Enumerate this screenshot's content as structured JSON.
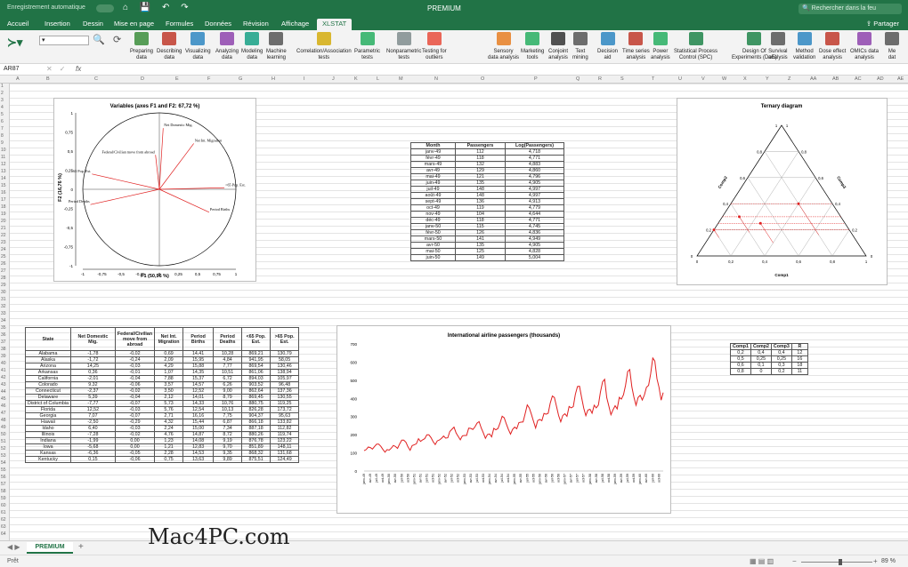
{
  "titlebar": {
    "autosave": "Enregistrement automatique",
    "title": "PREMIUM",
    "search_placeholder": "Rechercher dans la feu"
  },
  "tabs": [
    "Accueil",
    "Insertion",
    "Dessin",
    "Mise en page",
    "Formules",
    "Données",
    "Révision",
    "Affichage",
    "XLSTAT"
  ],
  "share": "Partager",
  "ribbon": {
    "buttons": [
      {
        "label": "Preparing\ndata",
        "icon": "prepare-data-icon",
        "color": "#3b8d3b"
      },
      {
        "label": "Describing\ndata",
        "icon": "bar-chart-icon",
        "color": "#c0392b"
      },
      {
        "label": "Visualizing\ndata",
        "icon": "visualize-icon",
        "color": "#2e86c1"
      },
      {
        "label": "Analyzing\ndata",
        "icon": "scatter-icon",
        "color": "#8e44ad"
      },
      {
        "label": "Modeling\ndata",
        "icon": "modeling-icon",
        "color": "#16a085"
      },
      {
        "label": "Machine\nlearning",
        "icon": "ml-icon",
        "color": "#555555"
      },
      {
        "label": "Correlation/Association\ntests",
        "icon": "correlation-icon",
        "color": "#d4ac0d"
      },
      {
        "label": "Parametric\ntests",
        "icon": "bell-curve-icon",
        "color": "#27ae60"
      },
      {
        "label": "Nonparametric\ntests",
        "icon": "nonparam-icon",
        "color": "#7f8c8d"
      },
      {
        "label": "Testing for\noutliers",
        "icon": "target-icon",
        "color": "#e74c3c"
      },
      {
        "label": "Sensory\ndata analysis",
        "icon": "orange-icon",
        "color": "#e67e22"
      },
      {
        "label": "Marketing\ntools",
        "icon": "marketing-icon",
        "color": "#27ae60"
      },
      {
        "label": "Conjoint\nanalysis",
        "icon": "cjt-icon",
        "color": "#333333"
      },
      {
        "label": "Text\nmining",
        "icon": "text-mining-icon",
        "color": "#555555"
      },
      {
        "label": "Decision\naid",
        "icon": "decision-icon",
        "color": "#2e86c1"
      },
      {
        "label": "Time series\nanalysis",
        "icon": "time-series-icon",
        "color": "#c0392b"
      },
      {
        "label": "Power\nanalysis",
        "icon": "pi-icon",
        "color": "#27ae60"
      },
      {
        "label": "Statistical Process\nControl (SPC)",
        "icon": "spc-icon",
        "color": "#1e8449"
      },
      {
        "label": "Design Of\nExperiments (DoE)",
        "icon": "doe-icon",
        "color": "#1e8449"
      },
      {
        "label": "Survival\nanalysis",
        "icon": "survival-icon",
        "color": "#555555"
      },
      {
        "label": "Method\nvalidation",
        "icon": "validation-icon",
        "color": "#2e86c1"
      },
      {
        "label": "Dose effect\nanalysis",
        "icon": "dose-icon",
        "color": "#c0392b"
      },
      {
        "label": "OMICs data\nanalysis",
        "icon": "omics-icon",
        "color": "#8e44ad"
      },
      {
        "label": "Me\ndat",
        "icon": "meta-icon",
        "color": "#555555"
      }
    ]
  },
  "formula_bar": {
    "name_box": "AR87",
    "fx": "fx"
  },
  "columns": [
    "A",
    "B",
    "C",
    "D",
    "E",
    "F",
    "G",
    "H",
    "I",
    "J",
    "K",
    "L",
    "M",
    "N",
    "O",
    "P",
    "Q",
    "R",
    "S",
    "T",
    "U",
    "V",
    "W",
    "X",
    "Y",
    "Z",
    "AA",
    "AB",
    "AC",
    "AD",
    "AE"
  ],
  "pca": {
    "title": "Variables (axes F1 and F2: 67,72 %)",
    "xlabel": "F1 (50,96 %)",
    "ylabel": "F2 (16,76 %)",
    "xticks": [
      "-1",
      "-0,75",
      "-0,5",
      "-0,25",
      "0",
      "0,25",
      "0,5",
      "0,75",
      "1"
    ],
    "yticks": [
      "1",
      "0,75",
      "0,5",
      "0,25",
      "0",
      "-0,25",
      "-0,5",
      "-0,75",
      "-1"
    ],
    "vectors": [
      {
        "name": "Net Domestic Mig.",
        "x": 0.05,
        "y": 0.8
      },
      {
        "name": "Net Int. Migration",
        "x": 0.45,
        "y": 0.6
      },
      {
        "name": "Federal/Civilian move from abroad",
        "x": -0.05,
        "y": 0.45
      },
      {
        "name": "<65 Pop. Est.",
        "x": -0.88,
        "y": 0.2
      },
      {
        "name": ">65 Pop. Est.",
        "x": 0.85,
        "y": 0.02
      },
      {
        "name": "Period Deaths",
        "x": -0.9,
        "y": -0.2
      },
      {
        "name": "Period Births",
        "x": 0.65,
        "y": -0.3
      }
    ]
  },
  "passengers": {
    "headers": [
      "Month",
      "Passengers",
      "Log(Passengers)"
    ],
    "rows": [
      [
        "janv-49",
        "112",
        "4,718"
      ],
      [
        "févr-49",
        "118",
        "4,771"
      ],
      [
        "mars-49",
        "132",
        "4,883"
      ],
      [
        "avr-49",
        "129",
        "4,860"
      ],
      [
        "mai-49",
        "121",
        "4,796"
      ],
      [
        "juin-49",
        "135",
        "4,905"
      ],
      [
        "juil-49",
        "148",
        "4,997"
      ],
      [
        "août-49",
        "148",
        "4,997"
      ],
      [
        "sept-49",
        "136",
        "4,913"
      ],
      [
        "oct-49",
        "119",
        "4,779"
      ],
      [
        "nov-49",
        "104",
        "4,644"
      ],
      [
        "déc-49",
        "118",
        "4,771"
      ],
      [
        "janv-50",
        "115",
        "4,745"
      ],
      [
        "févr-50",
        "126",
        "4,836"
      ],
      [
        "mars-50",
        "141",
        "4,949"
      ],
      [
        "avr-50",
        "135",
        "4,905"
      ],
      [
        "mai-50",
        "125",
        "4,828"
      ],
      [
        "juin-50",
        "149",
        "5,004"
      ]
    ]
  },
  "ternary": {
    "title": "Ternary diagram",
    "axis_labels": [
      "Comp1",
      "Comp2",
      "Comp3"
    ],
    "ticks": [
      "0",
      "0,2",
      "0,4",
      "0,6",
      "0,8",
      "1"
    ]
  },
  "state_table": {
    "headers": [
      "State",
      "Net Domestic Mig.",
      "Federal/Civilian move from abroad",
      "Net Int. Migration",
      "Period Births",
      "Period Deaths",
      "<65 Pop. Est.",
      ">65 Pop. Est."
    ],
    "rows": [
      [
        "Alabama",
        "-1,78",
        "-0,02",
        "0,69",
        "14,41",
        "10,28",
        "869,21",
        "130,79"
      ],
      [
        "Alaska",
        "-1,72",
        "-0,24",
        "2,09",
        "15,95",
        "4,84",
        "941,95",
        "58,05"
      ],
      [
        "Arizona",
        "14,25",
        "-0,03",
        "4,29",
        "15,88",
        "7,77",
        "869,54",
        "130,46"
      ],
      [
        "Arkansas",
        "0,36",
        "-0,01",
        "1,07",
        "14,35",
        "10,51",
        "861,06",
        "138,94"
      ],
      [
        "California",
        "-2,01",
        "-0,04",
        "7,88",
        "15,37",
        "6,72",
        "894,03",
        "105,97"
      ],
      [
        "Colorado",
        "9,32",
        "-0,06",
        "3,57",
        "14,57",
        "6,26",
        "903,52",
        "96,48"
      ],
      [
        "Connecticut",
        "-2,37",
        "-0,02",
        "3,50",
        "12,52",
        "9,00",
        "862,64",
        "137,36"
      ],
      [
        "Delaware",
        "5,39",
        "-0,04",
        "2,12",
        "14,01",
        "8,79",
        "869,45",
        "130,55"
      ],
      [
        "District of Columbia",
        "-7,77",
        "-0,07",
        "5,73",
        "14,33",
        "10,76",
        "880,75",
        "119,25"
      ],
      [
        "Florida",
        "12,52",
        "-0,03",
        "5,76",
        "12,54",
        "10,13",
        "826,28",
        "173,72"
      ],
      [
        "Georgia",
        "7,07",
        "-0,07",
        "2,71",
        "16,16",
        "7,75",
        "904,37",
        "95,63"
      ],
      [
        "Hawaii",
        "-2,50",
        "-0,29",
        "4,32",
        "15,44",
        "6,87",
        "866,18",
        "133,82"
      ],
      [
        "Idaho",
        "6,40",
        "-0,03",
        "2,24",
        "15,00",
        "7,34",
        "887,18",
        "112,82"
      ],
      [
        "Illinois",
        "-7,28",
        "-0,02",
        "4,76",
        "14,87",
        "8,72",
        "880,26",
        "119,74"
      ],
      [
        "Indiana",
        "-1,99",
        "0,00",
        "1,23",
        "14,08",
        "9,19",
        "876,78",
        "123,22"
      ],
      [
        "Iowa",
        "-5,68",
        "0,00",
        "1,21",
        "12,83",
        "9,70",
        "851,89",
        "148,11"
      ],
      [
        "Kansas",
        "-6,36",
        "-0,05",
        "2,28",
        "14,53",
        "9,35",
        "868,32",
        "131,68"
      ],
      [
        "Kentucky",
        "0,15",
        "-0,06",
        "0,75",
        "13,63",
        "9,89",
        "875,51",
        "124,49"
      ]
    ]
  },
  "comp_table": {
    "headers": [
      "Comp1",
      "Comp2",
      "Comp3",
      "R"
    ],
    "rows": [
      [
        "0,2",
        "0,4",
        "0,4",
        "12"
      ],
      [
        "0,5",
        "0,25",
        "0,25",
        "16"
      ],
      [
        "0,6",
        "0,1",
        "0,3",
        "18"
      ],
      [
        "0,8",
        "0",
        "0,2",
        "11"
      ]
    ]
  },
  "chart_data": {
    "type": "line",
    "title": "International airline passengers (thousands)",
    "ylim": [
      0,
      700
    ],
    "yticks": [
      "0",
      "100",
      "200",
      "300",
      "400",
      "500",
      "600",
      "700"
    ],
    "xtick_labels": [
      "janv-49",
      "avr-49",
      "juil-49",
      "oct-49",
      "janv-50",
      "avr-50",
      "juil-50",
      "oct-50",
      "janv-51",
      "avr-51",
      "juil-51",
      "oct-51",
      "janv-52",
      "avr-52",
      "juil-52",
      "oct-52",
      "janv-53",
      "avr-53",
      "juil-53",
      "oct-53",
      "janv-54",
      "avr-54",
      "juil-54",
      "oct-54",
      "janv-55",
      "avr-55",
      "juil-55",
      "oct-55",
      "janv-56",
      "avr-56",
      "juil-56",
      "oct-56",
      "janv-57",
      "avr-57",
      "juil-57",
      "oct-57",
      "janv-58",
      "avr-58",
      "juil-58",
      "oct-58",
      "janv-59",
      "avr-59",
      "juil-59",
      "oct-59",
      "janv-60",
      "avr-60",
      "juil-60",
      "oct-60"
    ],
    "series": [
      {
        "values": [
          112,
          118,
          132,
          129,
          121,
          135,
          148,
          148,
          136,
          119,
          104,
          118,
          115,
          126,
          141,
          135,
          125,
          149,
          170,
          170,
          158,
          133,
          114,
          140,
          145,
          150,
          178,
          163,
          172,
          178,
          199,
          199,
          184,
          162,
          146,
          166,
          171,
          180,
          193,
          181,
          183,
          218,
          230,
          242,
          209,
          191,
          172,
          194,
          196,
          196,
          236,
          235,
          229,
          243,
          264,
          272,
          237,
          211,
          180,
          201,
          204,
          188,
          235,
          227,
          234,
          264,
          302,
          293,
          259,
          229,
          203,
          229,
          242,
          233,
          267,
          269,
          270,
          315,
          364,
          347,
          312,
          274,
          237,
          278,
          284,
          277,
          317,
          313,
          318,
          374,
          413,
          405,
          355,
          306,
          271,
          306,
          315,
          301,
          356,
          348,
          355,
          422,
          465,
          467,
          404,
          347,
          305,
          336,
          340,
          318,
          362,
          348,
          363,
          435,
          491,
          505,
          404,
          359,
          310,
          337,
          360,
          342,
          406,
          396,
          420,
          472,
          548,
          559,
          463,
          407,
          362,
          405,
          417,
          391,
          419,
          461,
          472,
          535,
          622,
          606,
          508,
          461,
          390,
          432
        ]
      }
    ]
  },
  "sheet": {
    "tab": "PREMIUM",
    "add": "+"
  },
  "status": {
    "ready": "Prêt",
    "zoom": "89 %"
  },
  "watermark": "Mac4PC.com"
}
